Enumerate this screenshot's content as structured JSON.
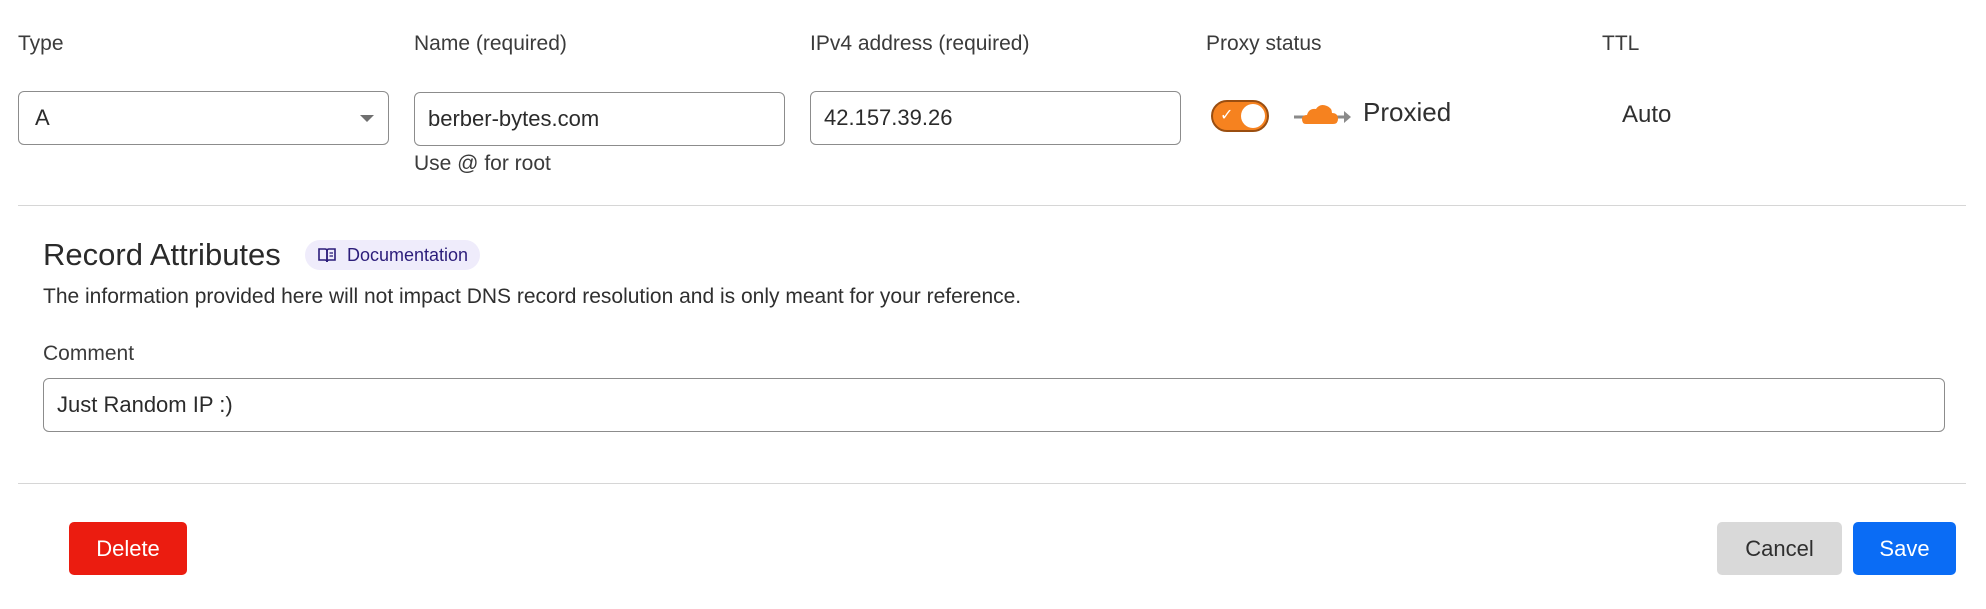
{
  "columns": {
    "type_label": "Type",
    "name_label": "Name (required)",
    "ipv4_label": "IPv4 address (required)",
    "proxy_label": "Proxy status",
    "ttl_label": "TTL"
  },
  "fields": {
    "type_value": "A",
    "name_value": "berber-bytes.com",
    "name_hint": "Use @ for root",
    "ipv4_value": "42.157.39.26",
    "proxy_text": "Proxied",
    "proxy_enabled": true,
    "ttl_value": "Auto"
  },
  "attributes": {
    "title": "Record Attributes",
    "docs_label": "Documentation",
    "description": "The information provided here will not impact DNS record resolution and is only meant for your reference.",
    "comment_label": "Comment",
    "comment_value": "Just Random IP :)"
  },
  "actions": {
    "delete_label": "Delete",
    "cancel_label": "Cancel",
    "save_label": "Save"
  },
  "colors": {
    "proxy_orange": "#f6821f",
    "delete_red": "#eb1c10",
    "save_blue": "#0a6cf5",
    "cancel_gray": "#d9d9d9",
    "badge_purple": "#2c1d7a"
  },
  "icons": {
    "type_dropdown": "chevron-down-icon",
    "toggle_check": "check-icon",
    "proxy_cloud": "cloud-icon",
    "docs_book": "book-icon"
  }
}
